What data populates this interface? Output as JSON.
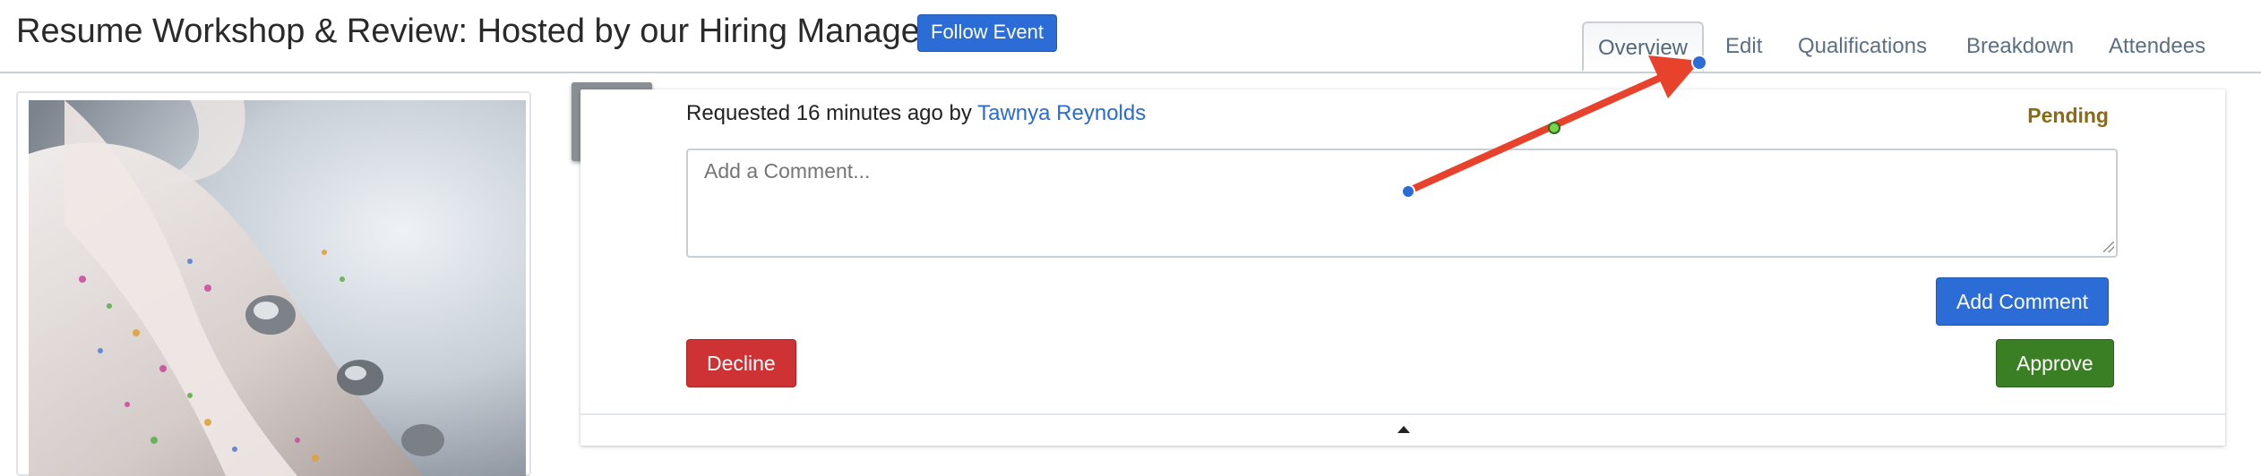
{
  "header": {
    "title": "Resume Workshop & Review: Hosted by our Hiring Manager!",
    "follow_button": "Follow Event"
  },
  "tabs": [
    {
      "label": "Overview",
      "active": true
    },
    {
      "label": "Edit"
    },
    {
      "label": "Qualifications"
    },
    {
      "label": "Breakdown"
    },
    {
      "label": "Attendees"
    }
  ],
  "request": {
    "prefix": "Requested 16 minutes ago by ",
    "user": "Tawnya Reynolds",
    "status": "Pending",
    "comment_placeholder": "Add a Comment...",
    "add_comment_button": "Add Comment",
    "decline_button": "Decline",
    "approve_button": "Approve"
  },
  "colors": {
    "accent": "#2b6cd6",
    "decline": "#cf3234",
    "approve": "#3b7f25",
    "pending": "#8a6a12",
    "annotation_arrow": "#e8412c"
  },
  "icons": {
    "collapse": "caret-up-icon"
  }
}
